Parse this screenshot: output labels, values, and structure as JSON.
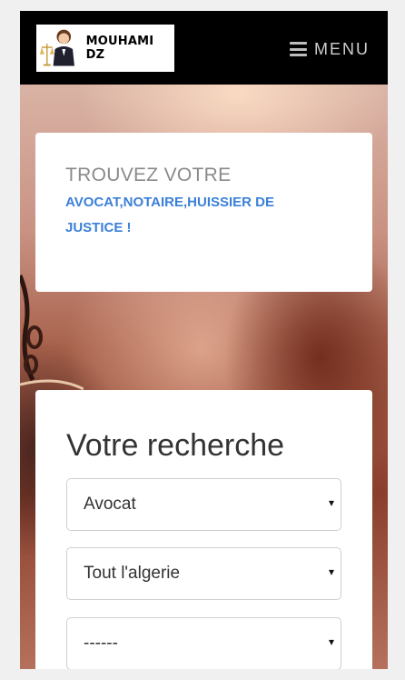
{
  "header": {
    "logo_text": "MOUHAMI DZ",
    "menu_label": "MENU"
  },
  "intro": {
    "title": "TROUVEZ VOTRE",
    "subtitle": "AVOCAT,NOTAIRE,HUISSIER DE JUSTICE !"
  },
  "search": {
    "title": "Votre recherche",
    "selects": [
      {
        "value": "Avocat"
      },
      {
        "value": "Tout l'algerie"
      },
      {
        "value": "------"
      }
    ]
  },
  "icons": {
    "menu": "hamburger-icon",
    "select_arrow": "▾"
  },
  "colors": {
    "navbar": "#000000",
    "accent": "#3b80d8"
  }
}
